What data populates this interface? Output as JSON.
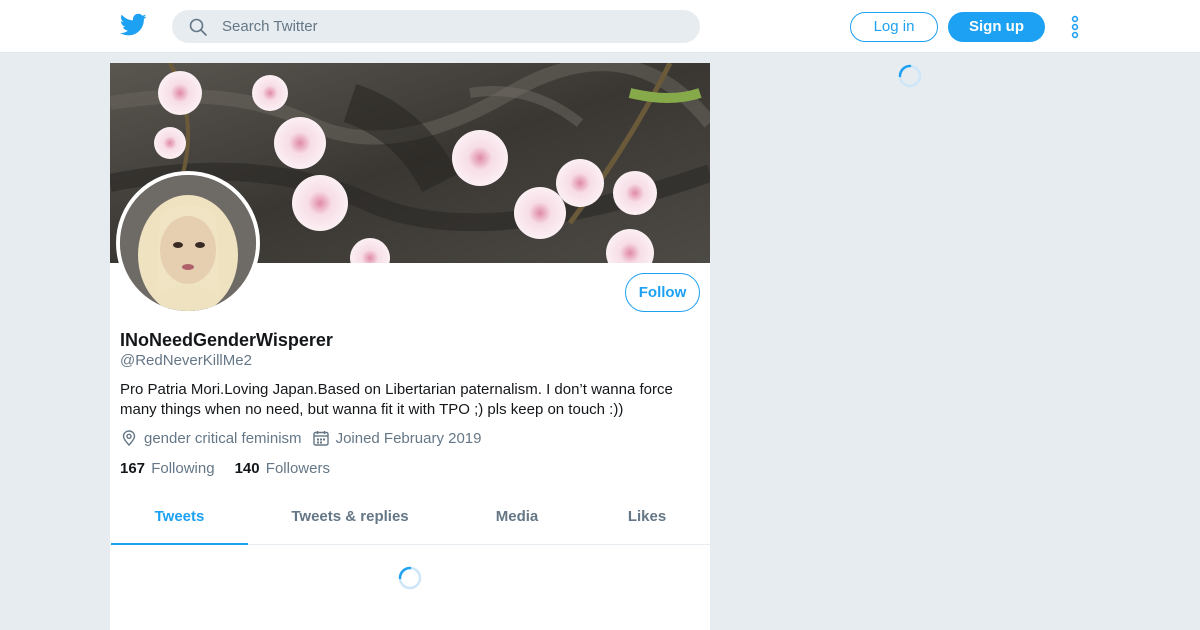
{
  "header": {
    "logo_icon": "twitter-bird-icon",
    "search_placeholder": "Search Twitter",
    "login_label": "Log in",
    "signup_label": "Sign up",
    "more_icon": "more-vertical-icon"
  },
  "profile": {
    "display_name": "INoNeedGenderWisperer",
    "handle": "@RedNeverKillMe2",
    "bio": "Pro Patria Mori.Loving Japan.Based on Libertarian paternalism. I don’t wanna force many things when no need, but wanna fit it with TPO ;) pls keep on touch :))",
    "location": "gender critical feminism",
    "joined": "Joined February 2019",
    "follow_label": "Follow",
    "following_count": "167",
    "following_label": "Following",
    "followers_count": "140",
    "followers_label": "Followers"
  },
  "tabs": [
    {
      "label": "Tweets",
      "active": true
    },
    {
      "label": "Tweets & replies",
      "active": false
    },
    {
      "label": "Media",
      "active": false
    },
    {
      "label": "Likes",
      "active": false
    }
  ],
  "colors": {
    "accent": "#1da1f2",
    "background": "#e6ecf0",
    "secondary_text": "#657786"
  }
}
